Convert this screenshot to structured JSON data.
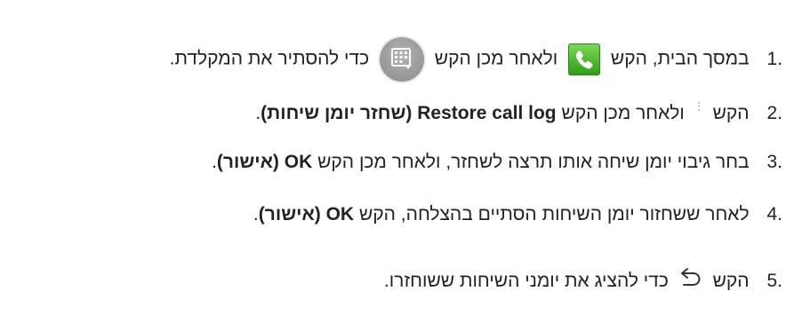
{
  "steps": [
    {
      "number": ".1",
      "text_a": "במסך הבית, הקש",
      "text_b": "ולאחר מכן הקש",
      "text_c": "כדי להסתיר את המקלדת."
    },
    {
      "number": ".2",
      "text_a": "הקש",
      "text_b": "ולאחר מכן הקש",
      "bold": "Restore call log (שחזר יומן שיחות)",
      "end": "."
    },
    {
      "number": ".3",
      "text_a": "בחר גיבוי יומן שיחה אותו תרצה לשחזר, ולאחר מכן הקש",
      "bold": "OK (אישור)",
      "end": "."
    },
    {
      "number": ".4",
      "text_a": "לאחר ששחזור יומן השיחות הסתיים בהצלחה, הקש",
      "bold": "OK (אישור)",
      "end": "."
    },
    {
      "number": ".5",
      "text_a": "הקש",
      "text_b": "כדי להציג את יומני השיחות ששוחזרו."
    }
  ],
  "icons": {
    "phone": "phone-icon",
    "keypad": "keypad-hide-icon",
    "menu": "menu-icon",
    "back": "back-icon",
    "phone_color": "#4cb82f",
    "keypad_color": "#9e9e9e"
  }
}
